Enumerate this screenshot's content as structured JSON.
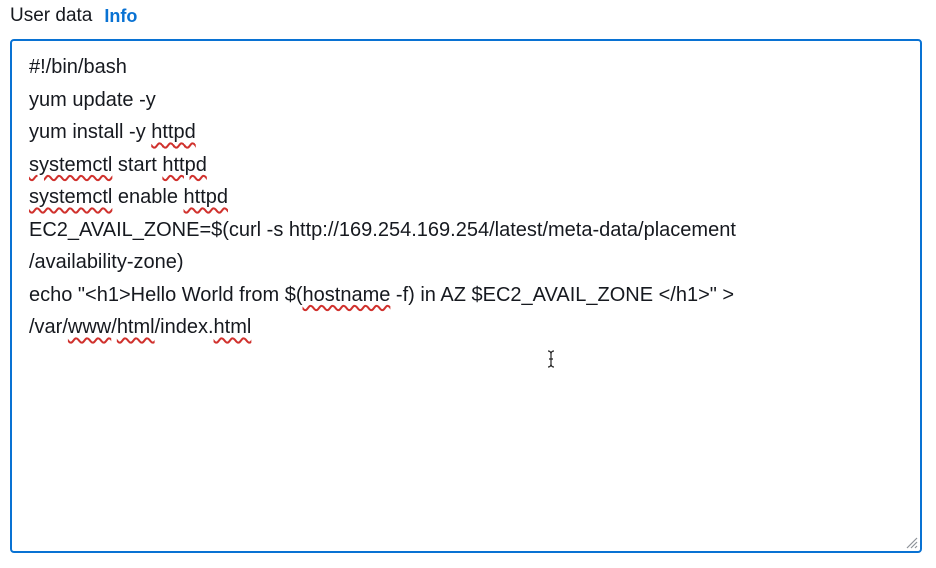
{
  "field": {
    "label": "User data",
    "info_link": "Info"
  },
  "script": {
    "lines": [
      {
        "segments": [
          {
            "text": "#!/bin/bash",
            "spell": false
          }
        ]
      },
      {
        "segments": [
          {
            "text": "yum update -y",
            "spell": false
          }
        ]
      },
      {
        "segments": [
          {
            "text": "yum install -y ",
            "spell": false
          },
          {
            "text": "httpd",
            "spell": true
          }
        ]
      },
      {
        "segments": [
          {
            "text": "systemctl",
            "spell": true
          },
          {
            "text": " start ",
            "spell": false
          },
          {
            "text": "httpd",
            "spell": true
          }
        ]
      },
      {
        "segments": [
          {
            "text": "systemctl",
            "spell": true
          },
          {
            "text": " enable ",
            "spell": false
          },
          {
            "text": "httpd",
            "spell": true
          }
        ]
      },
      {
        "segments": [
          {
            "text": "EC2_AVAIL_ZONE=$(curl -s http://169.254.169.254/latest/meta-data/placement",
            "spell": false
          }
        ]
      },
      {
        "segments": [
          {
            "text": "/availability-zone)",
            "spell": false
          }
        ]
      },
      {
        "segments": [
          {
            "text": "echo \"<h1>Hello World from $(",
            "spell": false
          },
          {
            "text": "hostname",
            "spell": true
          },
          {
            "text": " -f) in AZ $EC2_AVAIL_ZONE </h1>\" >",
            "spell": false
          }
        ]
      },
      {
        "segments": [
          {
            "text": "/var/",
            "spell": false
          },
          {
            "text": "www",
            "spell": true
          },
          {
            "text": "/",
            "spell": false
          },
          {
            "text": "html",
            "spell": true
          },
          {
            "text": "/index.",
            "spell": false
          },
          {
            "text": "html",
            "spell": true
          }
        ]
      }
    ]
  },
  "colors": {
    "accent": "#0972d3",
    "text": "#16191f",
    "spellcheck": "#d0312d"
  },
  "icons": {
    "resize_handle": "resize-grip-icon",
    "cursor": "text-cursor-icon"
  }
}
